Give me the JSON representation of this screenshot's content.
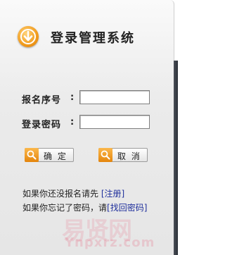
{
  "title": "登录管理系统",
  "form": {
    "reg_no_label": "报名序号",
    "password_label": "登录密码",
    "colon": ":",
    "reg_no_value": "",
    "password_value": ""
  },
  "buttons": {
    "confirm": "确 定",
    "cancel": "取 消"
  },
  "notes": {
    "line1_prefix": "如果你还没报名请先",
    "line1_link": "[注册]",
    "line2_prefix": "如果你忘记了密码，请",
    "line2_link": "[找回密码]"
  },
  "watermark": {
    "text_cn": "易贤网",
    "text_en": "Ynpxrz.com"
  },
  "colors": {
    "accent_orange": "#f19b1c",
    "link_blue": "#1f2f9c",
    "panel_bg": "#ececec"
  },
  "icons": [
    "download-arrow-icon",
    "search-icon"
  ]
}
